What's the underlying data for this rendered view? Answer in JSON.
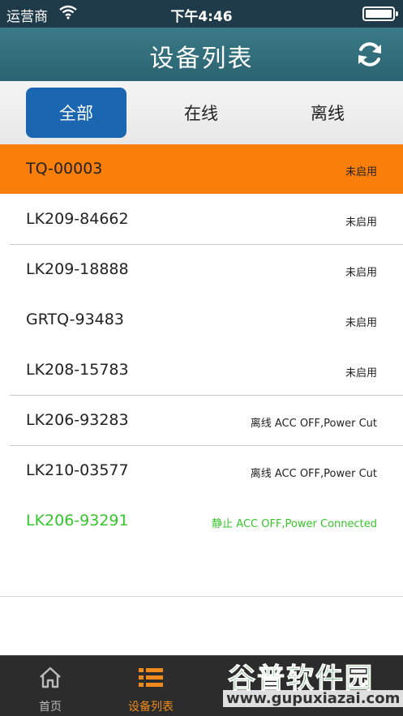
{
  "status_bar": {
    "carrier": "运营商",
    "time": "下午4:46"
  },
  "nav": {
    "title": "设备列表",
    "refresh_icon": "refresh-icon"
  },
  "segments": [
    {
      "label": "全部",
      "active": true
    },
    {
      "label": "在线",
      "active": false
    },
    {
      "label": "离线",
      "active": false
    }
  ],
  "devices": [
    {
      "name": "TQ-00003",
      "status": "未启用"
    },
    {
      "name": "LK209-84662",
      "status": "未启用"
    },
    {
      "name": "LK209-18888",
      "status": "未启用"
    },
    {
      "name": "GRTQ-93483",
      "status": "未启用"
    },
    {
      "name": "LK208-15783",
      "status": "未启用"
    },
    {
      "name": "LK206-93283",
      "status": "离线 ACC OFF,Power Cut"
    },
    {
      "name": "LK210-03577",
      "status": "离线 ACC OFF,Power Cut"
    },
    {
      "name": "LK206-93291",
      "status": "静止 ACC OFF,Power Connected"
    }
  ],
  "colors": {
    "highlight": "#fa7f0a",
    "green_status": "#35c42a",
    "nav_bg": "#2b6370",
    "segment_active": "#1b66b0",
    "tab_active": "#f08a1c"
  },
  "tabbar": {
    "items": [
      {
        "label": "首页",
        "icon": "home-icon",
        "active": false
      },
      {
        "label": "设备列表",
        "icon": "list-icon",
        "active": true
      }
    ]
  },
  "watermark": {
    "line1": "谷普软件园",
    "line2": "www.gupuxiazai.com"
  }
}
